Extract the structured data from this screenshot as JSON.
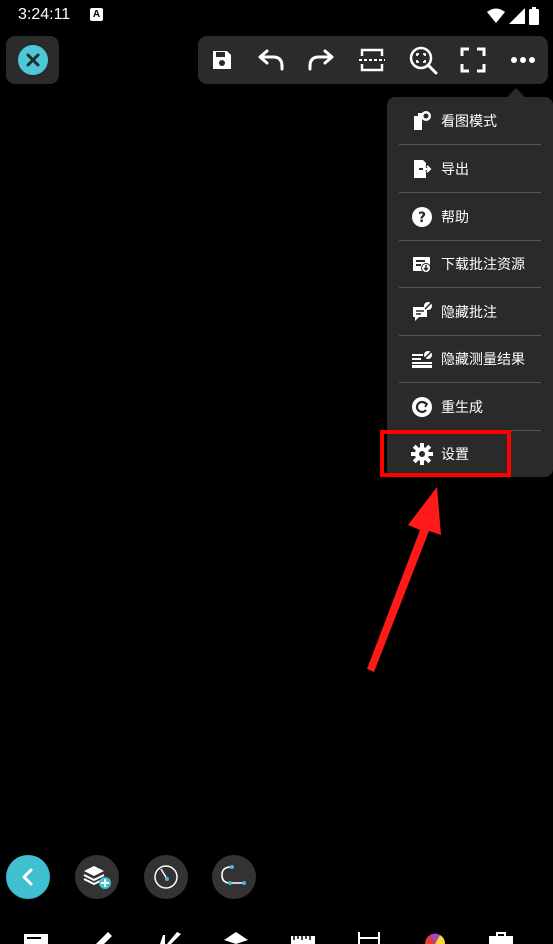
{
  "status": {
    "time": "3:24:11",
    "notification_letter": "A"
  },
  "toolbar": {
    "buttons": [
      "save-icon",
      "undo-icon",
      "redo-icon",
      "crop-icon",
      "zoom-fit-icon",
      "fullscreen-icon",
      "more-icon"
    ]
  },
  "menu": {
    "items": [
      {
        "label": "看图模式",
        "icon": "view-mode-icon"
      },
      {
        "label": "导出",
        "icon": "export-icon"
      },
      {
        "label": "帮助",
        "icon": "help-icon"
      },
      {
        "label": "下载批注资源",
        "icon": "download-annotation-icon"
      },
      {
        "label": "隐藏批注",
        "icon": "hide-annotation-icon"
      },
      {
        "label": "隐藏测量结果",
        "icon": "hide-measure-icon"
      },
      {
        "label": "重生成",
        "icon": "regenerate-icon"
      },
      {
        "label": "设置",
        "icon": "settings-icon"
      }
    ]
  },
  "colors": {
    "accent": "#4ec8d6",
    "panel": "#2b2b2b",
    "highlight": "#ff0000"
  }
}
